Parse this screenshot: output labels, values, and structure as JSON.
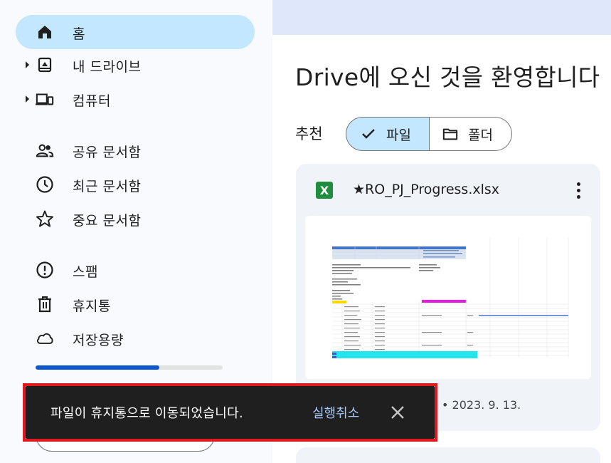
{
  "sidebar": {
    "items": [
      {
        "label": "홈",
        "icon": "home-icon",
        "active": true
      },
      {
        "label": "내 드라이브",
        "icon": "my-drive-icon",
        "expandable": true
      },
      {
        "label": "컴퓨터",
        "icon": "computers-icon",
        "expandable": true
      },
      {
        "label": "공유 문서함",
        "icon": "shared-people-icon"
      },
      {
        "label": "최근 문서함",
        "icon": "clock-icon"
      },
      {
        "label": "중요 문서함",
        "icon": "star-icon"
      },
      {
        "label": "스팸",
        "icon": "spam-icon"
      },
      {
        "label": "휴지통",
        "icon": "trash-icon"
      },
      {
        "label": "저장용량",
        "icon": "cloud-icon"
      }
    ],
    "storage_used_fraction": 0.66
  },
  "main": {
    "welcome": "Drive에 오신 것을 환영합니다",
    "recommended_label": "추천",
    "chips": [
      {
        "label": "파일",
        "icon": "check-icon",
        "selected": true
      },
      {
        "label": "폴더",
        "icon": "folder-icon",
        "selected": false
      }
    ],
    "file_card": {
      "type_badge": "X",
      "name": "★RO_PJ_Progress.xlsx",
      "date": "• 2023. 9. 13."
    }
  },
  "snackbar": {
    "message": "파일이 휴지통으로 이동되었습니다.",
    "action": "실행취소"
  },
  "colors": {
    "active_nav": "#c2e7ff",
    "accent_blue": "#0b57d0",
    "snackbar_bg": "#1f1f1f",
    "snackbar_action": "#a8c7fa",
    "highlight_outline": "#e0191f",
    "excel_green": "#1e8e3e"
  }
}
